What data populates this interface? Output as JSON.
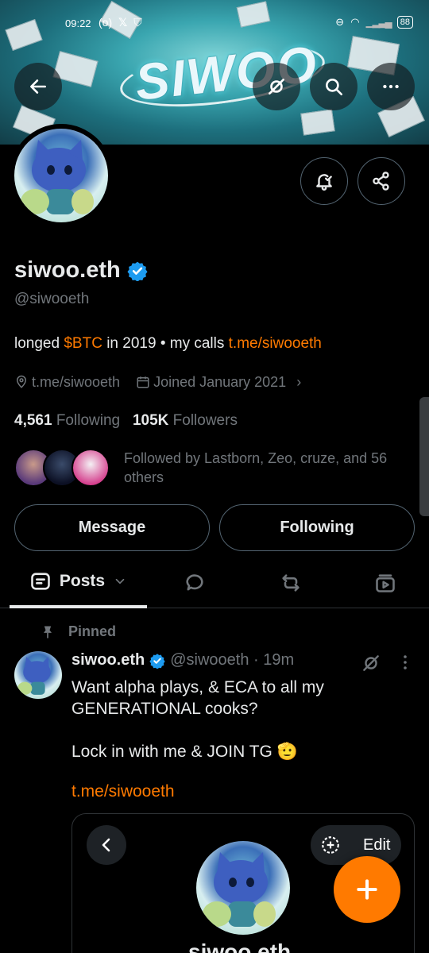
{
  "status_bar": {
    "time": "09:22",
    "battery": "88"
  },
  "banner": {
    "logo_text": "SIWOO"
  },
  "profile": {
    "name": "siwoo.eth",
    "handle": "@siwooeth",
    "bio_prefix": "longed ",
    "bio_ticker": "$BTC",
    "bio_middle": " in 2019 • my calls ",
    "bio_link": "t.me/siwooeth",
    "website": "t.me/siwooeth",
    "joined": "Joined January 2021",
    "following_count": "4,561",
    "following_label": "Following",
    "followers_count": "105K",
    "followers_label": "Followers",
    "followed_by": "Followed by Lastborn, Zeo, cruze, and 56 others"
  },
  "actions": {
    "message": "Message",
    "following": "Following"
  },
  "tabs": {
    "posts": "Posts"
  },
  "post": {
    "pinned_label": "Pinned",
    "author": "siwoo.eth",
    "handle_time": "@siwooeth · 19m",
    "line1": "Want alpha plays, & ECA to all my GENERATIONAL cooks?",
    "line2": "Lock in with me & JOIN TG 🫡",
    "link": "t.me/siwooeth",
    "card_edit": "Edit",
    "card_name": "siwoo.eth"
  },
  "colors": {
    "accent": "#ff7a00",
    "verified": "#1d9bf0",
    "muted": "#71767b",
    "border": "#536471"
  }
}
